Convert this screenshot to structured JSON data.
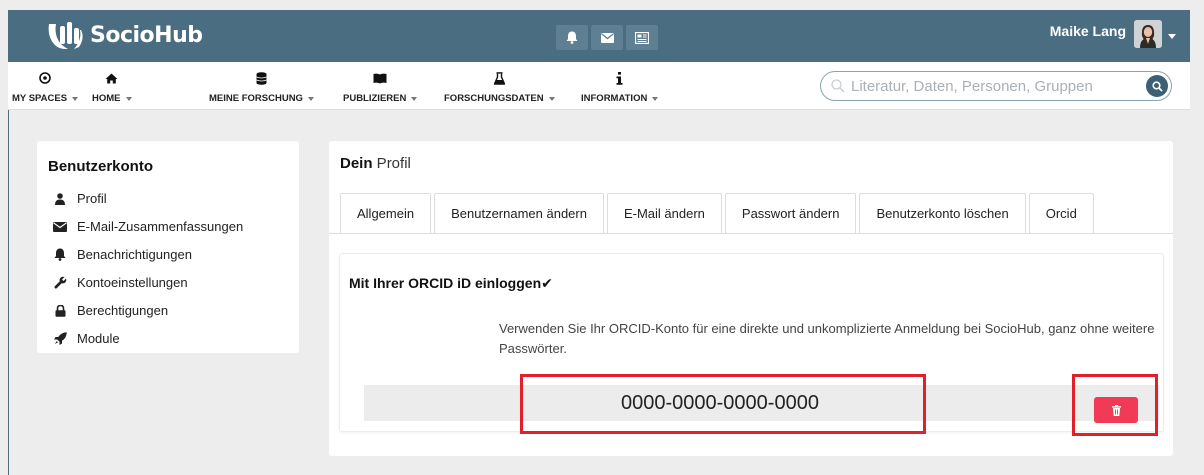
{
  "app": {
    "name": "SocioHub"
  },
  "user": {
    "name": "Maike Lang"
  },
  "nav": {
    "items": [
      {
        "label": "MY SPACES",
        "icon": "target-icon"
      },
      {
        "label": "HOME",
        "icon": "home-icon"
      },
      {
        "label": "MEINE FORSCHUNG",
        "icon": "database-icon"
      },
      {
        "label": "PUBLIZIEREN",
        "icon": "book-icon"
      },
      {
        "label": "FORSCHUNGSDATEN",
        "icon": "flask-icon"
      },
      {
        "label": "INFORMATION",
        "icon": "info-icon"
      }
    ]
  },
  "search": {
    "placeholder": "Literatur, Daten, Personen, Gruppen",
    "value": ""
  },
  "sidebar": {
    "title": "Benutzerkonto",
    "items": [
      {
        "label": "Profil",
        "icon": "user-icon"
      },
      {
        "label": "E-Mail-Zusammenfassungen",
        "icon": "envelope-icon"
      },
      {
        "label": "Benachrichtigungen",
        "icon": "bell-icon"
      },
      {
        "label": "Kontoeinstellungen",
        "icon": "wrench-icon"
      },
      {
        "label": "Berechtigungen",
        "icon": "lock-icon"
      },
      {
        "label": "Module",
        "icon": "rocket-icon"
      }
    ]
  },
  "profile": {
    "title_bold": "Dein",
    "title_rest": " Profil",
    "tabs": [
      "Allgemein",
      "Benutzernamen ändern",
      "E-Mail ändern",
      "Passwort ändern",
      "Benutzerkonto löschen",
      "Orcid"
    ],
    "orcid": {
      "heading": "Mit Ihrer ORCID iD einloggen✔",
      "description": "Verwenden Sie Ihr ORCID-Konto für eine direkte und unkomplizierte Anmeldung bei SocioHub, ganz ohne weitere Passwörter.",
      "id_value": "0000-0000-0000-0000"
    }
  },
  "colors": {
    "topbar": "#4b6d82",
    "highlight": "#e0202b",
    "delete_button": "#f03a56"
  }
}
